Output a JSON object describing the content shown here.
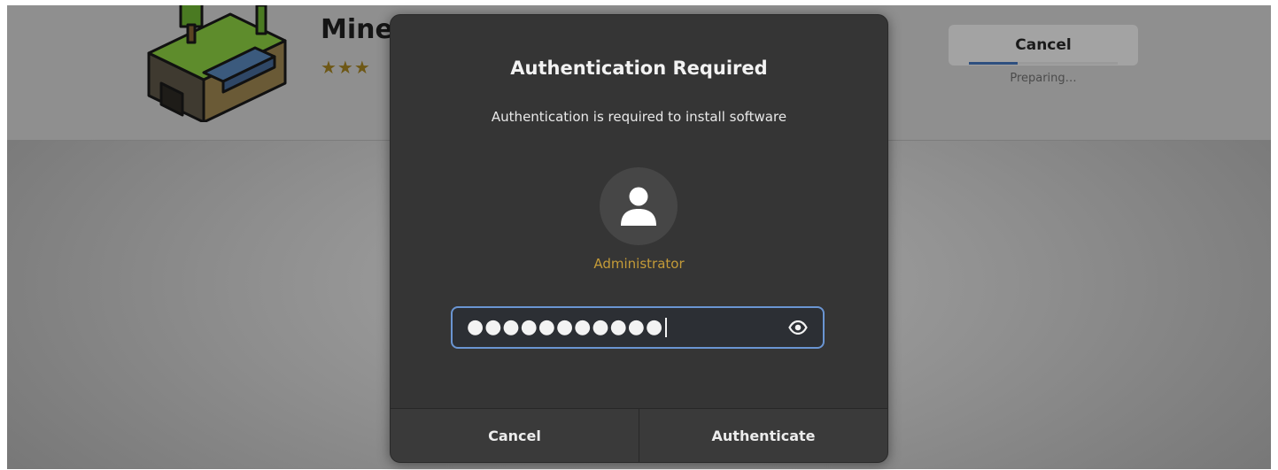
{
  "background_app": {
    "app_name": "Mine",
    "rating_stars": "★★★",
    "cancel_label": "Cancel",
    "status_text": "Preparing…",
    "install_progress_fraction": 0.33
  },
  "dialog": {
    "title": "Authentication Required",
    "message": "Authentication is required to install software",
    "user": {
      "name": "Administrator",
      "avatar_icon": "person-icon"
    },
    "password": {
      "masked_value": "●●●●●●●●●●●",
      "reveal_icon": "eye-icon"
    },
    "buttons": {
      "cancel_label": "Cancel",
      "authenticate_label": "Authenticate"
    }
  },
  "colors": {
    "dialog_bg": "#353535",
    "focus_accent": "#6a95d2",
    "user_name": "#c49b38"
  }
}
